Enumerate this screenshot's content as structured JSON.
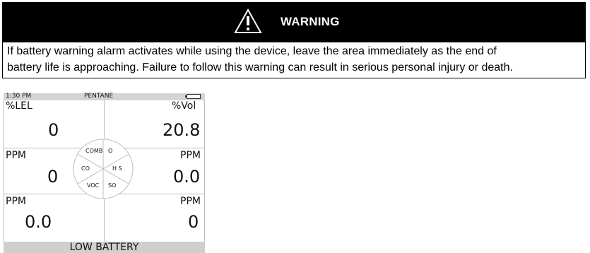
{
  "warning": {
    "title": "WARNING",
    "line1": "If battery warning alarm activates while using the device, leave the area immediately as the end of",
    "line2": "battery life is approaching. Failure to follow this warning can result in serious personal injury or death."
  },
  "device": {
    "status": {
      "time": "1:30 PM",
      "gas": "PENTANE"
    },
    "readings": {
      "lel": {
        "unit": "%LEL",
        "value": "0"
      },
      "o2": {
        "unit": "%Vol",
        "value": "20.8"
      },
      "co": {
        "unit": "PPM",
        "value": "0"
      },
      "h2s": {
        "unit": "PPM",
        "value": "0.0"
      },
      "voc": {
        "unit": "PPM",
        "value": "0.0"
      },
      "so2": {
        "unit": "PPM",
        "value": "0"
      }
    },
    "gauge": {
      "comb": "COMB",
      "o2": "O",
      "co": "CO",
      "h2s": "H S",
      "voc": "VOC",
      "so2": "SO"
    },
    "alert": "LOW BATTERY"
  }
}
